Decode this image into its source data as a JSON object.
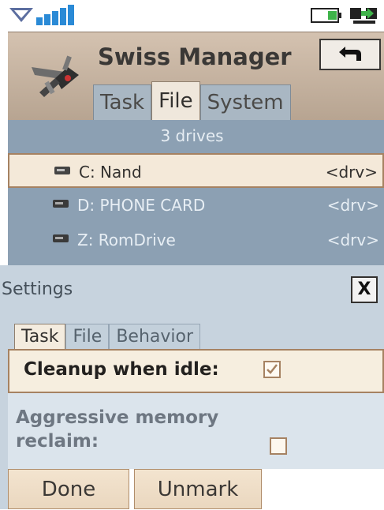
{
  "app": {
    "title": "Swiss Manager",
    "tabs": [
      {
        "label": "Task",
        "active": false
      },
      {
        "label": "File",
        "active": true
      },
      {
        "label": "System",
        "active": false
      }
    ]
  },
  "status_icons": [
    "notification-down-arrow-icon",
    "signal-strength-icon",
    "battery-icon",
    "data-transfer-icon"
  ],
  "main": {
    "drive_count": "3 drives",
    "drives": [
      {
        "name": "C: Nand",
        "type": "<drv>",
        "selected": true
      },
      {
        "name": "D: PHONE CARD",
        "type": "<drv>",
        "selected": false
      },
      {
        "name": "Z: RomDrive",
        "type": "<drv>",
        "selected": false
      }
    ]
  },
  "settings": {
    "title": "Settings",
    "close_label": "X",
    "tabs": [
      {
        "label": "Task",
        "active": true
      },
      {
        "label": "File",
        "active": false
      },
      {
        "label": "Behavior",
        "active": false
      }
    ],
    "options": [
      {
        "label": "Cleanup when idle:",
        "checked": true
      },
      {
        "label": "Aggressive memory reclaim:",
        "checked": false
      }
    ]
  },
  "softkeys": {
    "left": "Done",
    "middle": "Unmark"
  },
  "colors": {
    "accent": "#a68262",
    "header_bg": "#c3b19f",
    "list_bg": "#8ca0b3",
    "panel_bg": "#c7d3de",
    "selected_row_bg": "#f4e9d9"
  }
}
